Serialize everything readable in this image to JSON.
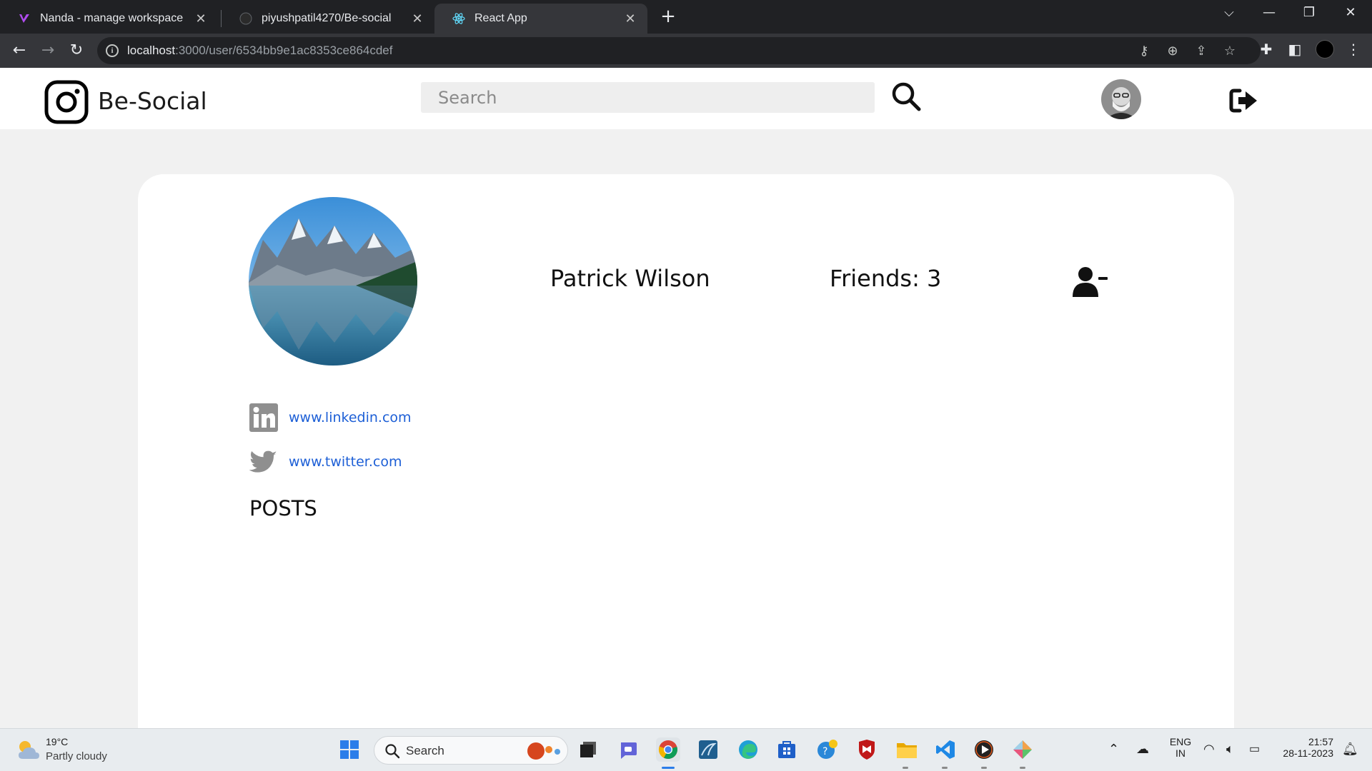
{
  "browser": {
    "tabs": [
      {
        "title": "Nanda - manage workspace",
        "icon": "nanda-icon"
      },
      {
        "title": "piyushpatil4270/Be-social",
        "icon": "github-icon"
      },
      {
        "title": "React App",
        "icon": "react-icon",
        "active": true
      }
    ],
    "url_host": "localhost",
    "url_path": ":3000/user/6534bb9e1ac8353ce864cdef"
  },
  "header": {
    "brand": "Be-Social",
    "search_placeholder": "Search"
  },
  "profile": {
    "name": "Patrick Wilson",
    "friends_label": "Friends: 3",
    "links": [
      {
        "icon": "linkedin-icon",
        "text": "www.linkedin.com"
      },
      {
        "icon": "twitter-icon",
        "text": "www.twitter.com"
      }
    ],
    "posts_title": "POSTS"
  },
  "taskbar": {
    "temperature": "19°C",
    "weather": "Partly cloudy",
    "search_label": "Search",
    "lang_top": "ENG",
    "lang_bottom": "IN",
    "time": "21:57",
    "date": "28-11-2023"
  },
  "colors": {
    "link": "#1d5fd6",
    "page_bg": "#f1f1f1",
    "tab_bar": "#202124",
    "toolbar": "#35363a"
  }
}
